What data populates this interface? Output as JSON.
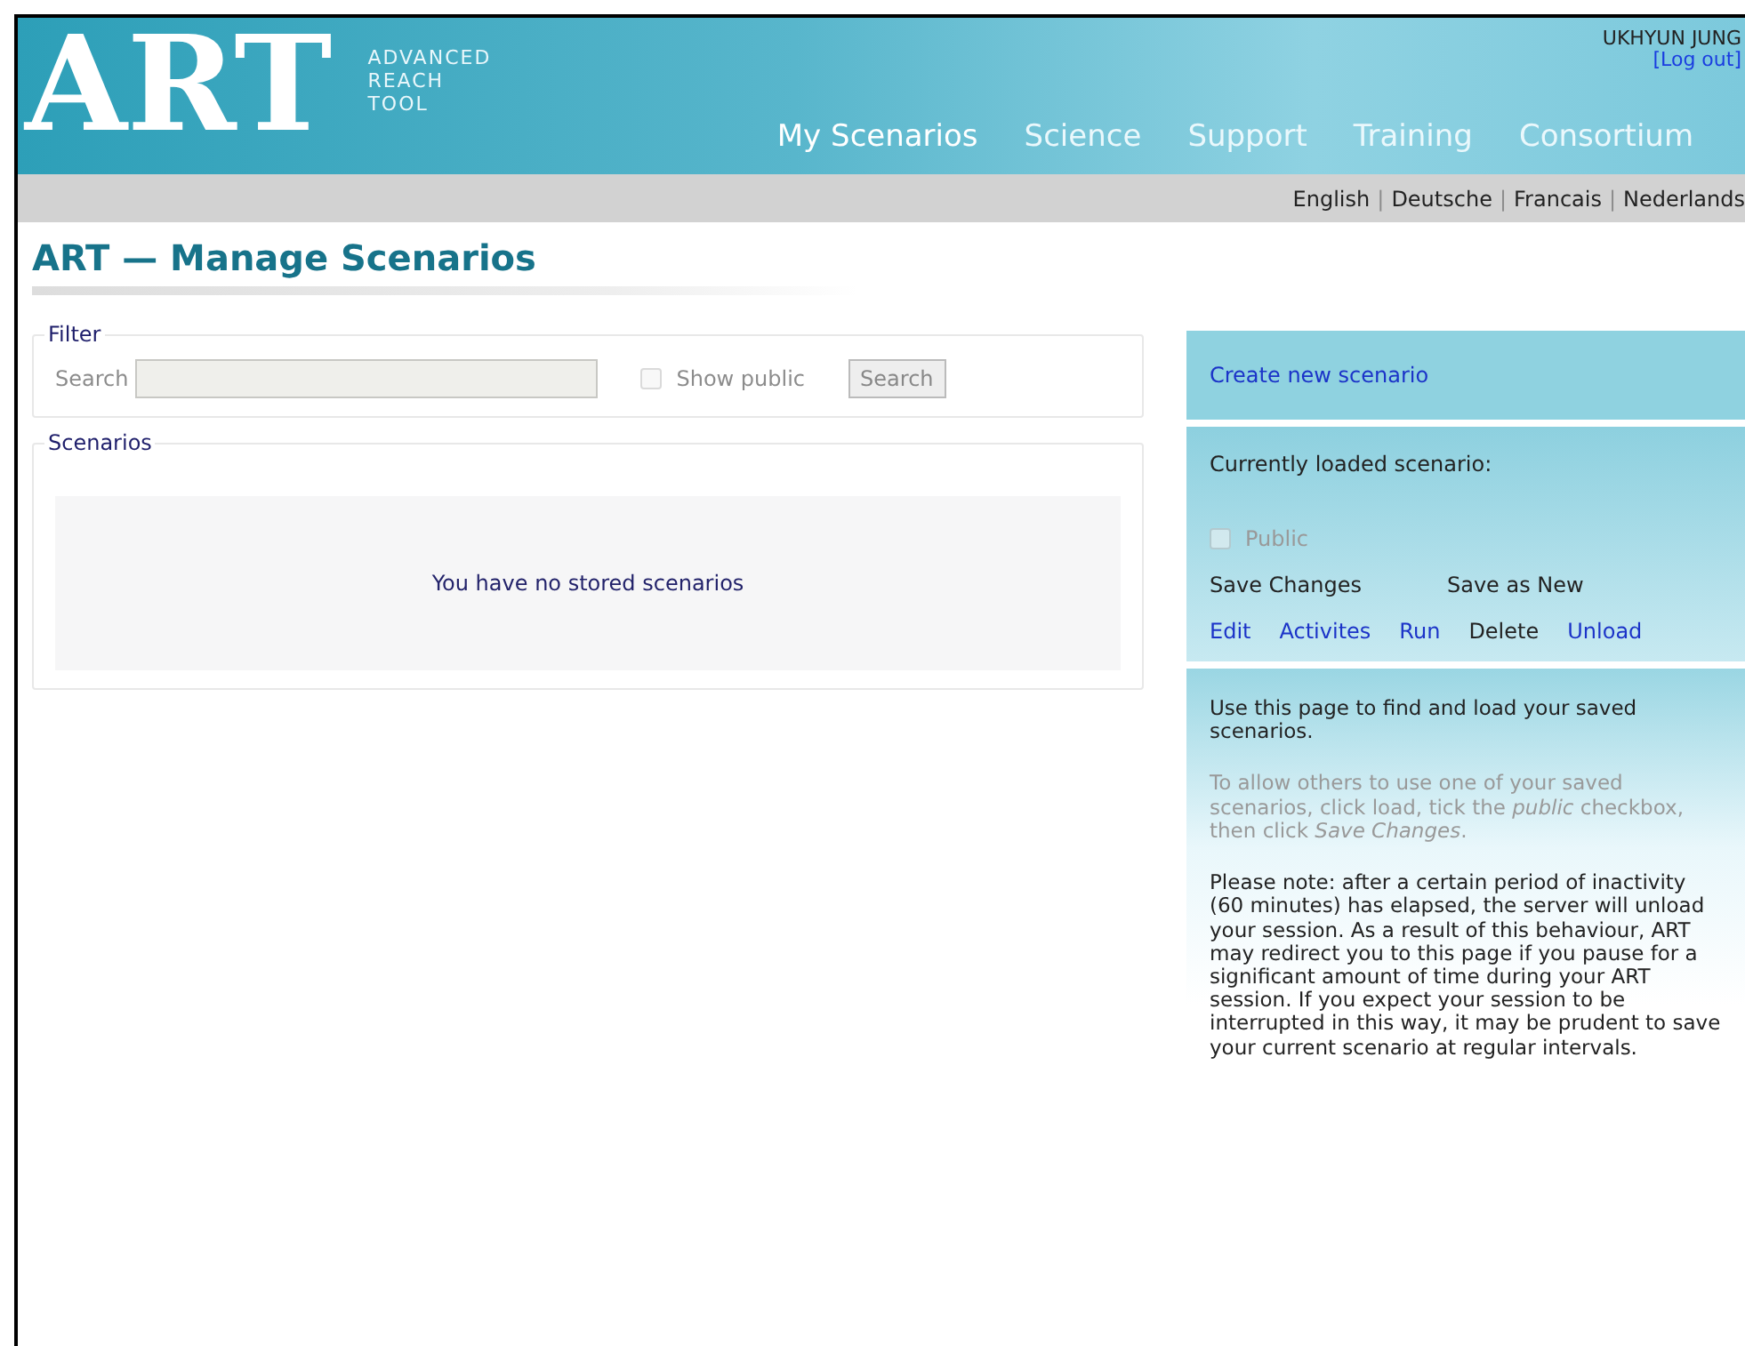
{
  "logo": {
    "mark": "ART",
    "lines": [
      "ADVANCED",
      "REACH",
      "TOOL"
    ]
  },
  "user": {
    "name": "UKHYUN JUNG",
    "logout": "[Log out]"
  },
  "nav": [
    {
      "label": "My Scenarios",
      "selected": true
    },
    {
      "label": "Science",
      "selected": false
    },
    {
      "label": "Support",
      "selected": false
    },
    {
      "label": "Training",
      "selected": false
    },
    {
      "label": "Consortium",
      "selected": false
    }
  ],
  "languages": [
    "English",
    "Deutsche",
    "Francais",
    "Nederlands"
  ],
  "language_separator": "|",
  "page_title": "ART — Manage Scenarios",
  "filter": {
    "legend": "Filter",
    "search_label": "Search",
    "show_public": {
      "label": "Show public",
      "checked": false,
      "disabled": true
    },
    "button": "Search"
  },
  "scenarios": {
    "legend": "Scenarios",
    "empty_message": "You have no stored scenarios"
  },
  "sidebar": {
    "create_link": "Create new scenario",
    "loaded_label": "Currently loaded scenario:",
    "public": {
      "label": "Public",
      "checked": false,
      "disabled": true
    },
    "save_actions": [
      {
        "label": "Save Changes",
        "kind": "text"
      },
      {
        "label": "Save as New",
        "kind": "text"
      }
    ],
    "actions": [
      {
        "label": "Edit",
        "kind": "link"
      },
      {
        "label": "Activites",
        "kind": "link"
      },
      {
        "label": "Run",
        "kind": "link"
      },
      {
        "label": "Delete",
        "kind": "text"
      },
      {
        "label": "Unload",
        "kind": "link"
      }
    ],
    "help": [
      {
        "text": "Use this page to find and load your saved scenarios.",
        "muted": false
      },
      {
        "text": "To allow others to use one of your saved scenarios, click load, tick the *public* checkbox, then click *Save Changes*.",
        "muted": true
      },
      {
        "text": "Please note: after a certain period of inactivity (60 minutes) has elapsed, the server will unload your session. As a result of this behaviour, ART may redirect you to this page if you pause for a significant amount of time during your ART session. If you expect your session to be interrupted in this way, it may be prudent to save your current scenario at regular intervals.",
        "muted": false
      }
    ]
  }
}
